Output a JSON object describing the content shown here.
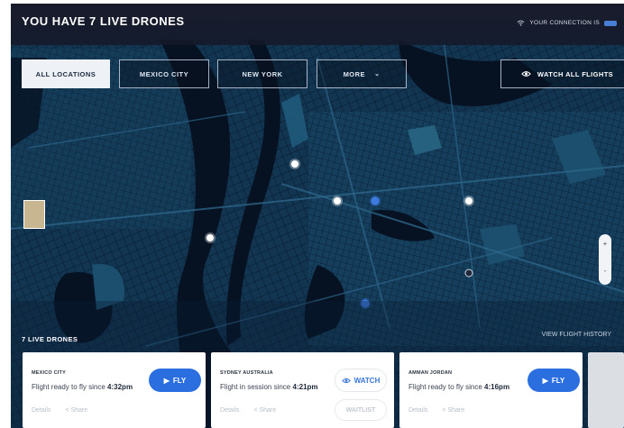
{
  "header": {
    "title": "YOU HAVE 7 LIVE DRONES",
    "connection_label": "YOUR CONNECTION IS",
    "connection_status": ""
  },
  "filters": [
    {
      "label": "ALL LOCATIONS",
      "active": true
    },
    {
      "label": "MEXICO CITY",
      "active": false
    },
    {
      "label": "NEW YORK",
      "active": false
    },
    {
      "label": "MORE",
      "active": false
    }
  ],
  "watch_all": {
    "label": "WATCH ALL FLIGHTS",
    "icon": "eye-icon"
  },
  "map": {
    "zoom_in": "+",
    "zoom_out": "-",
    "markers": [
      {
        "color": "#ffffff",
        "kind": "drone"
      },
      {
        "color": "#ffffff",
        "kind": "drone"
      },
      {
        "color": "#ffffff",
        "kind": "drone"
      },
      {
        "color": "#ffffff",
        "kind": "drone"
      },
      {
        "color": "#3d7be0",
        "kind": "drone"
      },
      {
        "color": "#3d7be0",
        "kind": "drone"
      },
      {
        "color": "#1e2a3c",
        "kind": "drone"
      }
    ]
  },
  "list": {
    "heading": "7 LIVE DRONES",
    "history_link": "VIEW FLIGHT HISTORY"
  },
  "cards": [
    {
      "location": "MEXICO CITY",
      "status": "Flight ready to fly since",
      "time": "4:32pm",
      "action": "FLY",
      "details": "Details",
      "share": "Share"
    },
    {
      "location": "SYDNEY AUSTRALIA",
      "status": "Flight in session since",
      "time": "4:21pm",
      "action": "WATCH",
      "secondary": "WAITLIST",
      "details": "Details",
      "share": "Share"
    },
    {
      "location": "AMMAN JORDAN",
      "status": "Flight ready to fly since",
      "time": "4:16pm",
      "action": "FLY",
      "details": "Details",
      "share": "Share"
    }
  ],
  "colors": {
    "accent": "#2a6ee0",
    "map_bg": "#0b1e33",
    "water": "#061222"
  }
}
